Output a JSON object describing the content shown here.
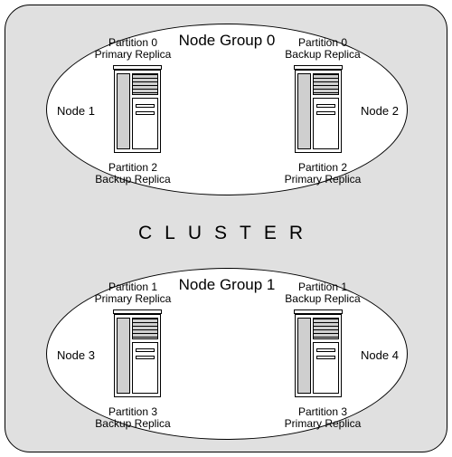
{
  "cluster_label": "CLUSTER",
  "groups": [
    {
      "title": "Node Group 0",
      "left_node_label": "Node 1",
      "right_node_label": "Node 2",
      "top_left": {
        "part": "Partition 0",
        "role": "Primary Replica"
      },
      "top_right": {
        "part": "Partition 0",
        "role": "Backup Replica"
      },
      "bottom_left": {
        "part": "Partition 2",
        "role": "Backup Replica"
      },
      "bottom_right": {
        "part": "Partition 2",
        "role": "Primary Replica"
      }
    },
    {
      "title": "Node Group 1",
      "left_node_label": "Node 3",
      "right_node_label": "Node 4",
      "top_left": {
        "part": "Partition 1",
        "role": "Primary Replica"
      },
      "top_right": {
        "part": "Partition 1",
        "role": "Backup Replica"
      },
      "bottom_left": {
        "part": "Partition 3",
        "role": "Backup Replica"
      },
      "bottom_right": {
        "part": "Partition 3",
        "role": "Primary Replica"
      }
    }
  ]
}
